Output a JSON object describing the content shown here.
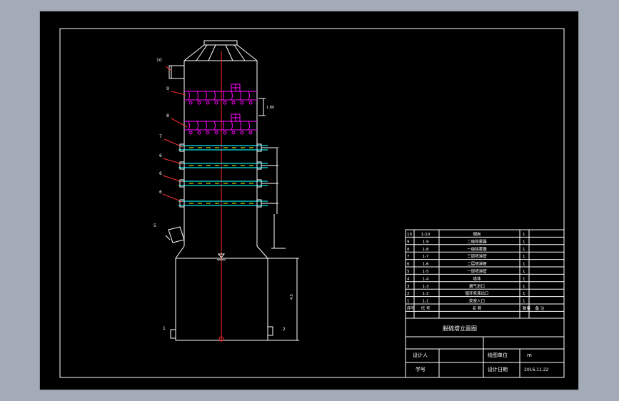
{
  "colors": {
    "background": "#a3acb6",
    "drawing_bg": "#000000",
    "line": "#ffffff",
    "centerline": "#ff2a2a",
    "magenta": "#ff00ff",
    "cyan": "#00e5e5",
    "yellow": "#ffff00"
  },
  "callouts": [
    "10",
    "9",
    "8",
    "7",
    "6",
    "6",
    "6",
    "5",
    "1",
    "2"
  ],
  "dimensions": [
    "1.80",
    "4.5"
  ],
  "parts_table": {
    "rows": [
      {
        "no": "10",
        "code": "1-10",
        "name": "烟囱",
        "qty": "1",
        "note": ""
      },
      {
        "no": "9",
        "code": "1-9",
        "name": "二级除雾器",
        "qty": "1",
        "note": ""
      },
      {
        "no": "8",
        "code": "1-8",
        "name": "一级除雾器",
        "qty": "1",
        "note": ""
      },
      {
        "no": "7",
        "code": "1-7",
        "name": "三层喷淋管",
        "qty": "1",
        "note": ""
      },
      {
        "no": "6",
        "code": "1-6",
        "name": "二层喷淋管",
        "qty": "1",
        "note": ""
      },
      {
        "no": "5",
        "code": "1-5",
        "name": "一层喷淋管",
        "qty": "1",
        "note": ""
      },
      {
        "no": "4",
        "code": "1-4",
        "name": "塔体",
        "qty": "1",
        "note": ""
      },
      {
        "no": "3",
        "code": "1-3",
        "name": "烟气进口",
        "qty": "1",
        "note": ""
      },
      {
        "no": "2",
        "code": "1-2",
        "name": "循环浆液出口",
        "qty": "1",
        "note": ""
      },
      {
        "no": "1",
        "code": "1-1",
        "name": "浆液入口",
        "qty": "1",
        "note": ""
      }
    ],
    "header": {
      "no": "序号",
      "code": "代 号",
      "name": "名 称",
      "qty": "数量",
      "note": "备 注"
    }
  },
  "title_block": {
    "drawing_title": "脱硫塔立面图",
    "designer_label": "设计人",
    "designer_value": "",
    "unit_label": "绘图单位",
    "unit_value": "m",
    "student_no_label": "学号",
    "student_no_value": "",
    "date_label": "设计日期",
    "date_value": "2016.11.22"
  }
}
